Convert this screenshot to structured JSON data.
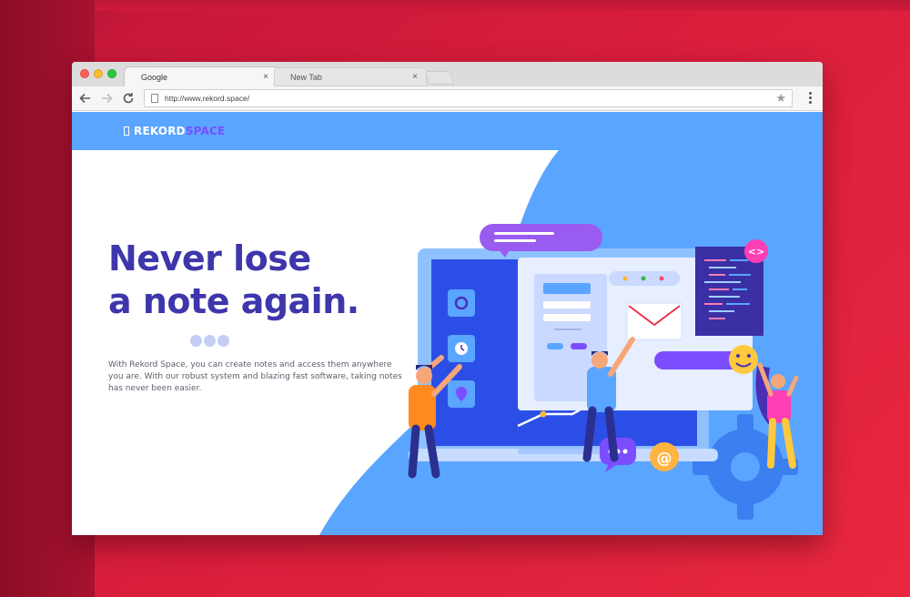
{
  "browser": {
    "tabs": [
      {
        "label": "Google"
      },
      {
        "label": "New Tab"
      }
    ],
    "tab_close_glyph": "×",
    "url": "http://www.rekord.space/",
    "icons": {
      "back": "arrow-left-icon",
      "forward": "arrow-right-icon",
      "reload": "reload-icon",
      "bookmark": "star-icon",
      "menu": "kebab-menu-icon"
    }
  },
  "site": {
    "logo": {
      "part1": "REKORD",
      "part2": "SPACE"
    },
    "headline": {
      "line1": "Never lose",
      "line2": "a note again."
    },
    "description": "With Rekord Space, you can create notes and access them anywhere you are. With our robust system and blazing fast software, taking notes has never been easier.",
    "code_badge": "<>",
    "at_badge": "@"
  },
  "colors": {
    "background": "#d81d3c",
    "hero_blue": "#5aa5ff",
    "headline": "#3e36ab",
    "logo_accent": "#7c4dff"
  }
}
